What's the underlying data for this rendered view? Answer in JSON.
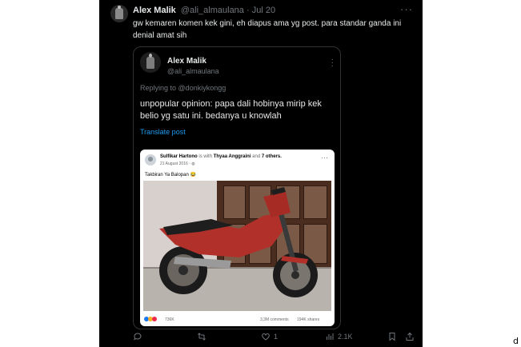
{
  "tweet": {
    "name": "Alex Malik",
    "handle": "@ali_almaulana",
    "date": "Jul 20",
    "separator": "·",
    "text": "gw kemaren komen kek gini, eh diapus ama yg post. para standar ganda ini denial amat sih"
  },
  "quoted": {
    "name": "Alex Malik",
    "handle": "@ali_almaulana",
    "reply_prefix": "Replying to",
    "reply_to": "@donkiykongg",
    "text": "unpopular opinion: papa dali hobinya mirip kek belio yg satu ini. bedanya u knowlah",
    "translate_label": "Translate post"
  },
  "facebook_post": {
    "author": "Sulfikar Hartono",
    "with_text": "is with",
    "tagged": "Thyaa Anggraini",
    "and_text": "and",
    "others": "7 others.",
    "date": "21 August 2016 · ",
    "caption": "Takbiran Ya Balopan 😂",
    "reactions_count": "736K",
    "comments": "3,3M comments",
    "shares": "194K shares"
  },
  "actions": {
    "replies": "",
    "reposts": "",
    "likes": "1",
    "views": "2.1K"
  },
  "corner_glyph": "d",
  "colors": {
    "background": "#000000",
    "text": "#e7e9ea",
    "muted": "#71767b",
    "link": "#1d9bf0",
    "border": "#2f3336"
  }
}
